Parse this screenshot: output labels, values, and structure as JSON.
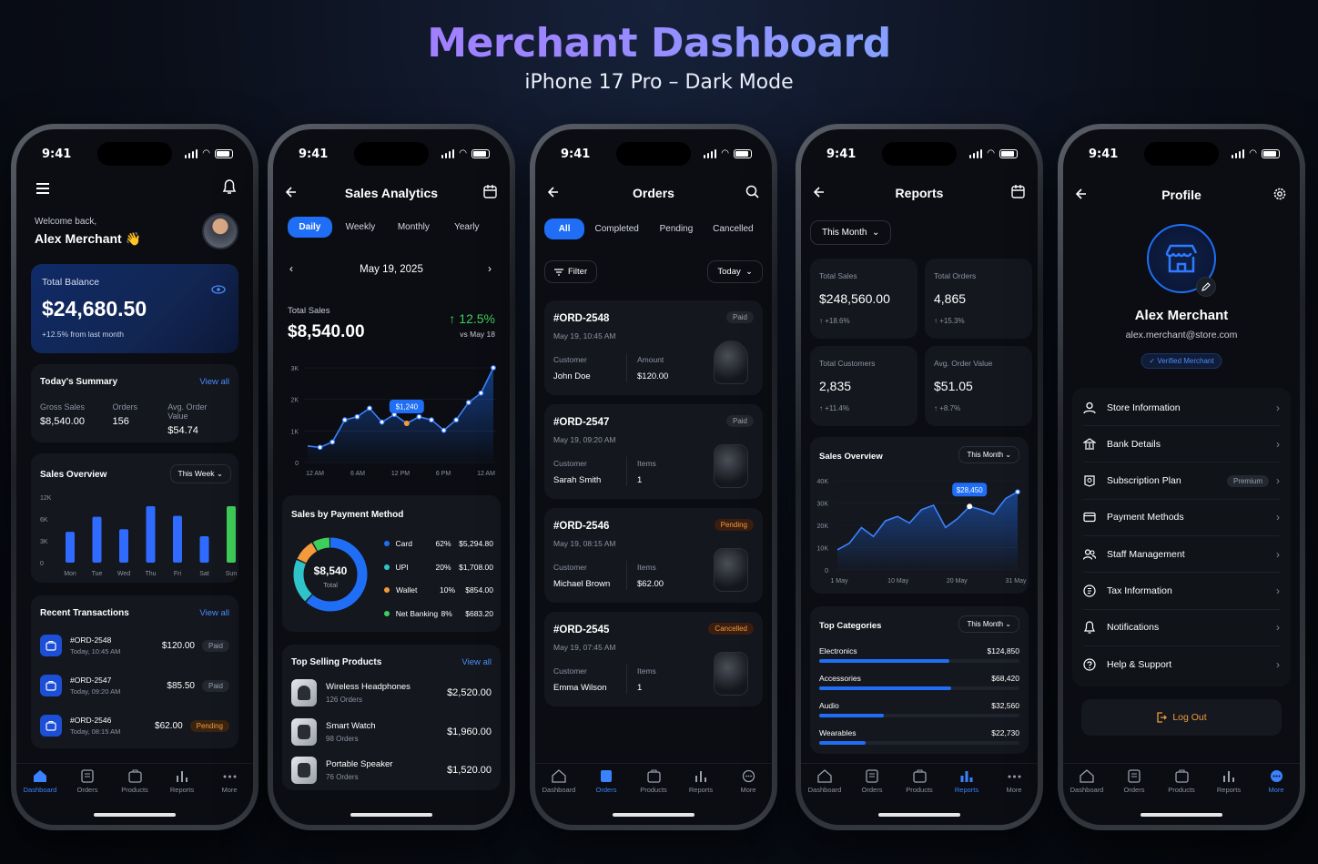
{
  "header": {
    "title": "Merchant Dashboard",
    "subtitle": "iPhone 17 Pro – Dark Mode"
  },
  "status_time": "9:41",
  "colors": {
    "accent": "#1f6ef5",
    "green": "#3ecf5a",
    "orange": "#f29a3c",
    "bg": "#0b0d12",
    "card": "#14171e"
  },
  "tabs": [
    "Dashboard",
    "Orders",
    "Products",
    "Reports",
    "More"
  ],
  "dashboard": {
    "welcome": "Welcome back,",
    "name": "Alex Merchant 👋",
    "balance_label": "Total Balance",
    "balance": "$24,680.50",
    "balance_change": "+12.5% from last month",
    "summary_title": "Today's Summary",
    "view_all": "View all",
    "summary": [
      {
        "label": "Gross Sales",
        "value": "$8,540.00"
      },
      {
        "label": "Orders",
        "value": "156"
      },
      {
        "label": "Avg. Order Value",
        "value": "$54.74"
      }
    ],
    "overview_title": "Sales Overview",
    "overview_filter": "This Week",
    "overview_yticks": [
      "12K",
      "6K",
      "3K",
      "0"
    ],
    "overview_days": [
      "Mon",
      "Tue",
      "Wed",
      "Thu",
      "Fri",
      "Sat",
      "Sun"
    ],
    "overview_values": [
      3.5,
      5.2,
      3.8,
      6.4,
      5.3,
      3,
      6.4
    ],
    "recent_title": "Recent Transactions",
    "transactions": [
      {
        "id": "#ORD-2548",
        "time": "Today, 10:45 AM",
        "amount": "$120.00",
        "status": "Paid"
      },
      {
        "id": "#ORD-2547",
        "time": "Today, 09:20 AM",
        "amount": "$85.50",
        "status": "Paid"
      },
      {
        "id": "#ORD-2546",
        "time": "Today, 08:15 AM",
        "amount": "$62.00",
        "status": "Pending"
      }
    ]
  },
  "analytics": {
    "title": "Sales Analytics",
    "periods": [
      "Daily",
      "Weekly",
      "Monthly",
      "Yearly"
    ],
    "date": "May 19, 2025",
    "total_label": "Total Sales",
    "total": "$8,540.00",
    "change": "↑ 12.5%",
    "change_sub": "vs May 18",
    "tooltip": "$1,240",
    "payment_title": "Sales by Payment Method",
    "donut_value": "$8,540",
    "donut_label": "Total",
    "payments": [
      {
        "name": "Card",
        "pct": "62%",
        "amount": "$5,294.80",
        "color": "#1f6ef5",
        "share": 62
      },
      {
        "name": "UPI",
        "pct": "20%",
        "amount": "$1,708.00",
        "color": "#2ec4c9",
        "share": 20
      },
      {
        "name": "Wallet",
        "pct": "10%",
        "amount": "$854.00",
        "color": "#f29a3c",
        "share": 10
      },
      {
        "name": "Net Banking",
        "pct": "8%",
        "amount": "$683.20",
        "color": "#3ecf5a",
        "share": 8
      }
    ],
    "top_title": "Top Selling Products",
    "view_all": "View all",
    "products": [
      {
        "name": "Wireless Headphones",
        "orders": "126 Orders",
        "amount": "$2,520.00"
      },
      {
        "name": "Smart Watch",
        "orders": "98 Orders",
        "amount": "$1,960.00"
      },
      {
        "name": "Portable Speaker",
        "orders": "76 Orders",
        "amount": "$1,520.00"
      }
    ]
  },
  "chart_data": [
    {
      "type": "line",
      "title": "",
      "x": [
        "12 AM",
        "3 AM",
        "6 AM",
        "9 AM",
        "12 PM",
        "3 PM",
        "6 PM",
        "9 PM",
        "12 AM"
      ],
      "x_ticks": [
        "12 AM",
        "6 AM",
        "12 PM",
        "6 PM",
        "12 AM"
      ],
      "y_ticks": [
        "3K",
        "2K",
        "1K",
        "0"
      ],
      "ylim": [
        0,
        3000
      ],
      "series": [
        {
          "values": [
            520,
            480,
            650,
            1350,
            1450,
            1720,
            1280,
            1520,
            1240,
            1450,
            1350,
            1020,
            1350,
            1900,
            2200,
            3000
          ]
        }
      ]
    },
    {
      "type": "line",
      "title": "Sales Overview",
      "x_ticks": [
        "1 May",
        "10 May",
        "20 May",
        "31 May"
      ],
      "y_ticks": [
        "40K",
        "30K",
        "20K",
        "10K",
        "0"
      ],
      "ylim": [
        0,
        40000
      ],
      "series": [
        {
          "values": [
            9000,
            12000,
            19000,
            15000,
            22000,
            24000,
            21000,
            27000,
            29000,
            19000,
            23000,
            28450,
            27000,
            25000,
            32000,
            35000
          ]
        }
      ]
    }
  ],
  "orders": {
    "title": "Orders",
    "filters": [
      "All",
      "Completed",
      "Pending",
      "Cancelled"
    ],
    "filter_btn": "Filter",
    "date_btn": "Today",
    "customer_label": "Customer",
    "items_label": "Items",
    "list": [
      {
        "id": "#ORD-2548",
        "time": "May 19, 10:45 AM",
        "status": "Paid",
        "customer": "John Doe",
        "col2_label": "Amount",
        "col2": "$120.00"
      },
      {
        "id": "#ORD-2547",
        "time": "May 19, 09:20 AM",
        "status": "Paid",
        "customer": "Sarah Smith",
        "col2_label": "Items",
        "col2": "1"
      },
      {
        "id": "#ORD-2546",
        "time": "May 19, 08:15 AM",
        "status": "Pending",
        "customer": "Michael Brown",
        "col2_label": "Items",
        "col2": "$62.00"
      },
      {
        "id": "#ORD-2545",
        "time": "May 19, 07:45 AM",
        "status": "Cancelled",
        "customer": "Emma Wilson",
        "col2_label": "Items",
        "col2": "1"
      }
    ]
  },
  "reports": {
    "title": "Reports",
    "period": "This Month",
    "kpis": [
      {
        "label": "Total Sales",
        "value": "$248,560.00",
        "change": "↑ +18.6%"
      },
      {
        "label": "Total Orders",
        "value": "4,865",
        "change": "↑ +15.3%"
      },
      {
        "label": "Total Customers",
        "value": "2,835",
        "change": "↑ +11.4%"
      },
      {
        "label": "Avg. Order Value",
        "value": "$51.05",
        "change": "↑ +8.7%"
      }
    ],
    "overview_title": "Sales Overview",
    "overview_filter": "This Month",
    "tooltip": "$28,450",
    "cat_title": "Top Categories",
    "cat_filter": "This Month",
    "categories": [
      {
        "name": "Electronics",
        "amount": "$124,850",
        "share": 0.62
      },
      {
        "name": "Accessories",
        "amount": "$68,420",
        "share": 0.63
      },
      {
        "name": "Audio",
        "amount": "$32,560",
        "share": 0.31
      },
      {
        "name": "Wearables",
        "amount": "$22,730",
        "share": 0.22
      }
    ]
  },
  "profile": {
    "title": "Profile",
    "name": "Alex Merchant",
    "email": "alex.merchant@store.com",
    "badge": "✓ Verified Merchant",
    "menu": [
      {
        "label": "Store Information",
        "icon": "user-icon"
      },
      {
        "label": "Bank Details",
        "icon": "bank-icon"
      },
      {
        "label": "Subscription Plan",
        "icon": "subscription-icon",
        "tag": "Premium"
      },
      {
        "label": "Payment Methods",
        "icon": "card-icon"
      },
      {
        "label": "Staff Management",
        "icon": "staff-icon"
      },
      {
        "label": "Tax Information",
        "icon": "tax-icon"
      },
      {
        "label": "Notifications",
        "icon": "bell-icon"
      },
      {
        "label": "Help & Support",
        "icon": "help-icon"
      }
    ],
    "logout": "Log Out"
  }
}
